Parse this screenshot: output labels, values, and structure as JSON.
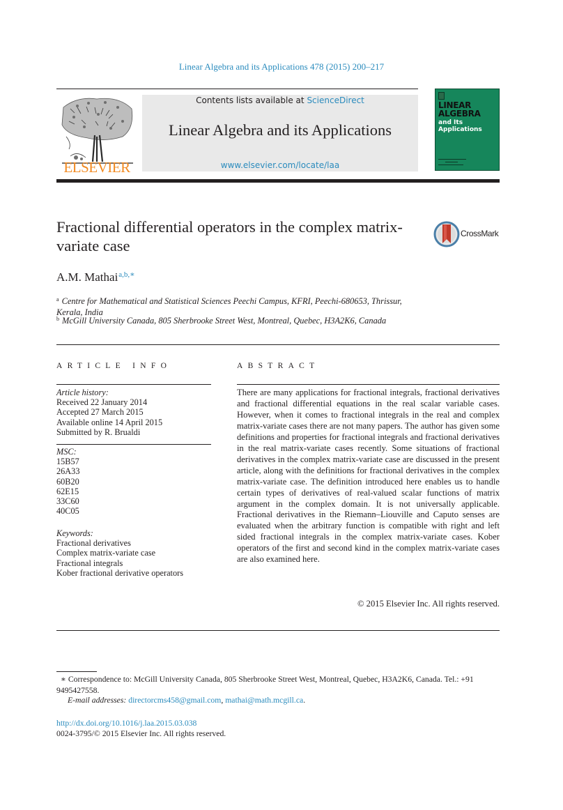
{
  "running_head": "Linear Algebra and its Applications 478 (2015) 200–217",
  "masthead": {
    "contents_prefix": "Contents lists available at ",
    "contents_link": "ScienceDirect",
    "journal_title": "Linear Algebra and its Applications",
    "journal_url": "www.elsevier.com/locate/laa",
    "publisher": "ELSEVIER",
    "cover": {
      "line1": "LINEAR",
      "line2": "ALGEBRA",
      "line3": "and Its",
      "line4": "Applications",
      "color": "#16865b"
    }
  },
  "article": {
    "title": "Fractional differential operators in the complex matrix-variate case",
    "crossmark_label": "CrossMark",
    "author": "A.M. Mathai",
    "author_marks": "a,b,∗",
    "affiliations": [
      {
        "mark": "a",
        "text": "Centre for Mathematical and Statistical Sciences Peechi Campus, KFRI, Peechi-680653, Thrissur, Kerala, India"
      },
      {
        "mark": "b",
        "text": "McGill University Canada, 805 Sherbrooke Street West, Montreal, Quebec, H3A2K6, Canada"
      }
    ]
  },
  "article_info": {
    "heading": "ARTICLE INFO",
    "history_label": "Article history:",
    "history": [
      "Received 22 January 2014",
      "Accepted 27 March 2015",
      "Available online 14 April 2015",
      "Submitted by R. Brualdi"
    ],
    "msc_label": "MSC:",
    "msc": [
      "15B57",
      "26A33",
      "60B20",
      "62E15",
      "33C60",
      "40C05"
    ],
    "keywords_label": "Keywords:",
    "keywords": [
      "Fractional derivatives",
      "Complex matrix-variate case",
      "Fractional integrals",
      "Kober fractional derivative operators"
    ]
  },
  "abstract": {
    "heading": "ABSTRACT",
    "text": "There are many applications for fractional integrals, fractional derivatives and fractional differential equations in the real scalar variable cases. However, when it comes to fractional integrals in the real and complex matrix-variate cases there are not many papers. The author has given some definitions and properties for fractional integrals and fractional deriva­tives in the real matrix-variate cases recently. Some situations of fractional derivatives in the complex matrix-variate case are discussed in the present article, along with the definitions for fractional derivatives in the complex matrix-variate case. The definition introduced here enables us to handle certain types of derivatives of real-valued scalar functions of matrix argument in the complex domain. It is not universally applicable. Fractional derivatives in the Riemann–Liouville and Caputo senses are evaluated when the arbitrary function is compatible with right and left sided fractional integrals in the complex matrix-variate cases. Kober operators of the first and second kind in the complex matrix-variate cases are also examined here.",
    "copyright": "© 2015 Elsevier Inc. All rights reserved."
  },
  "footnotes": {
    "corr_mark": "∗",
    "correspondence": "Correspondence to: McGill University Canada, 805 Sherbrooke Street West, Montreal, Quebec, H3A2K6, Canada. Tel.: +91 9495427558.",
    "email_label": "E-mail addresses:",
    "emails": [
      "directorcms458@gmail.com",
      "mathai@math.mcgill.ca"
    ],
    "email_sep": ", ",
    "email_end": ".",
    "doi": "http://dx.doi.org/10.1016/j.laa.2015.03.038",
    "issn": "0024-3795/© 2015 Elsevier Inc. All rights reserved."
  },
  "colors": {
    "link": "#2a8bbd",
    "elsevier_orange": "#f28a21",
    "masthead_bg": "#e9e9e9",
    "crossmark_red": "#c0392b"
  }
}
